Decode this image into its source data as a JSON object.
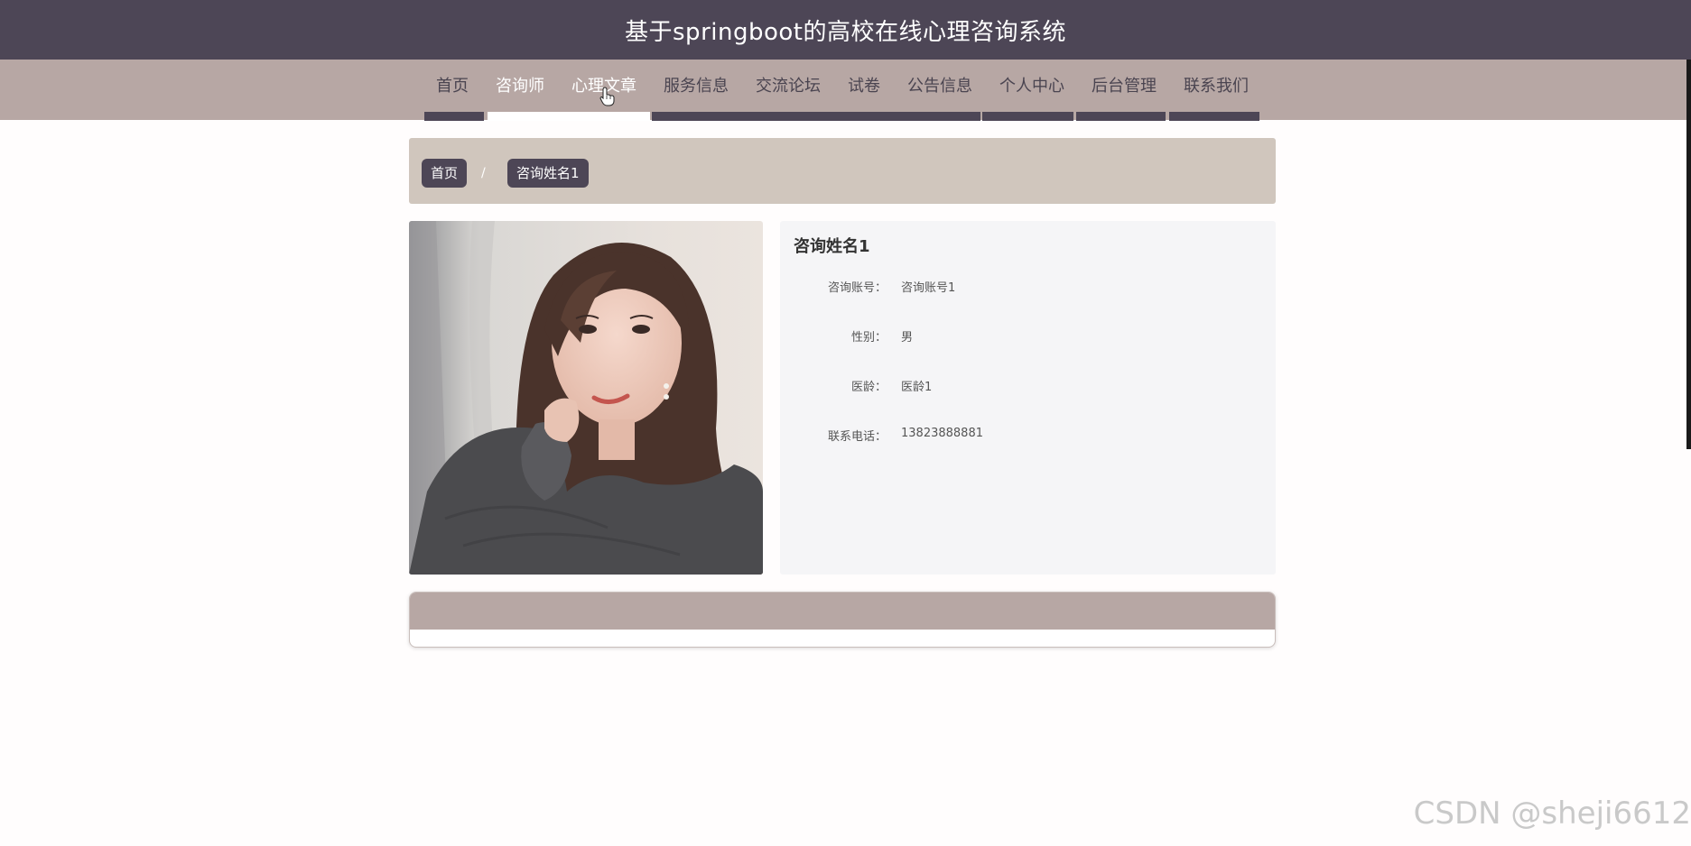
{
  "header": {
    "title": "基于springboot的高校在线心理咨询系统"
  },
  "nav": {
    "items": [
      "首页",
      "咨询师",
      "心理文章",
      "服务信息",
      "交流论坛",
      "试卷",
      "公告信息",
      "个人中心",
      "后台管理",
      "联系我们"
    ],
    "active_index": 1
  },
  "breadcrumb": {
    "home": "首页",
    "separator": "/",
    "current": "咨询姓名1"
  },
  "detail": {
    "name": "咨询姓名1",
    "rows": [
      {
        "label": "咨询账号：",
        "value": "咨询账号1"
      },
      {
        "label": "性别：",
        "value": "男"
      },
      {
        "label": "医龄：",
        "value": "医龄1"
      },
      {
        "label": "联系电话：",
        "value": "13823888881"
      }
    ]
  },
  "watermark": "CSDN @sheji6612",
  "colors": {
    "header_bg": "#4d4656",
    "nav_bg": "#b7a7a4",
    "breadcrumb_bg": "#d0c6bd",
    "panel_bg": "#f5f5f7"
  }
}
